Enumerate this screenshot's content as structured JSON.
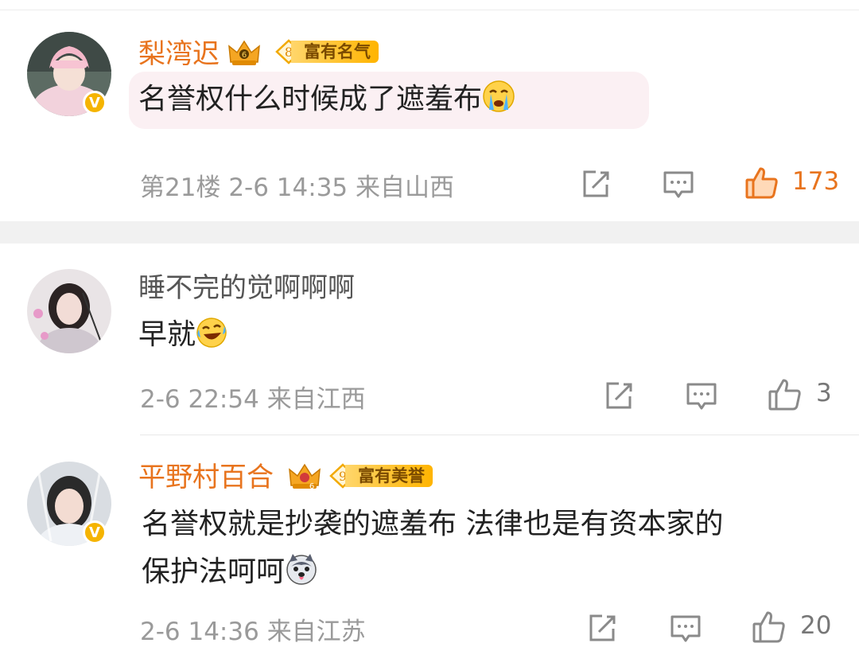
{
  "comments": [
    {
      "username": "梨湾迟",
      "level_badge": "8",
      "honor_badge": "富有名气",
      "text": "名誉权什么时候成了遮羞布",
      "emoji": "crying-emoji",
      "floor": "第21楼",
      "time": "2-6 14:35",
      "location": "来自山西",
      "likes": "173",
      "liked": true
    },
    {
      "username": "睡不完的觉啊啊啊",
      "text": "早就",
      "emoji": "laugh-cry-emoji",
      "time": "2-6 22:54",
      "location": "来自江西",
      "likes": "3",
      "liked": false
    },
    {
      "username": "平野村百合",
      "level_badge": "9",
      "honor_badge": "富有美誉",
      "text_line1": "名誉权就是抄袭的遮羞布 法律也是有资本家的",
      "text_line2": "保护法呵呵",
      "emoji": "husky-emoji",
      "time": "2-6 14:36",
      "location": "来自江苏",
      "likes": "20",
      "liked": false
    }
  ],
  "colors": {
    "vip_name": "#e8741e",
    "liked": "#e8741e",
    "meta": "#9a9a9a",
    "bubble": "#fbf0f3",
    "verified_badge": "#f5b400"
  },
  "icons": [
    "verified-v-icon",
    "crown-icon",
    "level-diamond-icon",
    "share-icon",
    "reply-icon",
    "like-icon"
  ],
  "verified_mark": "V"
}
